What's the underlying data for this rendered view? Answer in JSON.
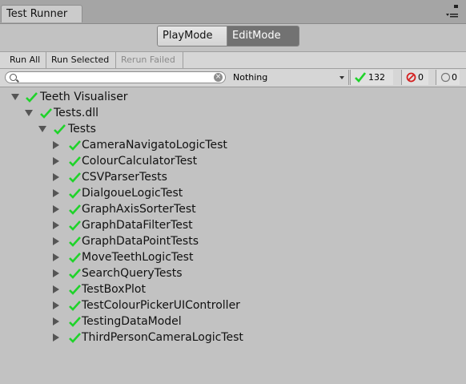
{
  "window": {
    "tab_title": "Test Runner"
  },
  "modes": {
    "play": "PlayMode",
    "edit": "EditMode",
    "active": "EditMode"
  },
  "toolbar": {
    "run_all": "Run All",
    "run_selected": "Run Selected",
    "rerun_failed": "Rerun Failed"
  },
  "filter": {
    "search_value": "",
    "category_selected": "Nothing",
    "passed_count": "132",
    "failed_count": "0",
    "skipped_count": "0"
  },
  "colors": {
    "pass": "#1fd32a",
    "fail": "#d42020",
    "active_mode": "#727272"
  },
  "tree": {
    "root": "Teeth Visualiser",
    "assembly": "Tests.dll",
    "namespace": "Tests",
    "fixtures": [
      "CameraNavigatoLogicTest",
      "ColourCalculatorTest",
      "CSVParserTests",
      "DialgoueLogicTest",
      "GraphAxisSorterTest",
      "GraphDataFilterTest",
      "GraphDataPointTests",
      "MoveTeethLogicTest",
      "SearchQueryTests",
      "TestBoxPlot",
      "TestColourPickerUIController",
      "TestingDataModel",
      "ThirdPersonCameraLogicTest"
    ]
  }
}
